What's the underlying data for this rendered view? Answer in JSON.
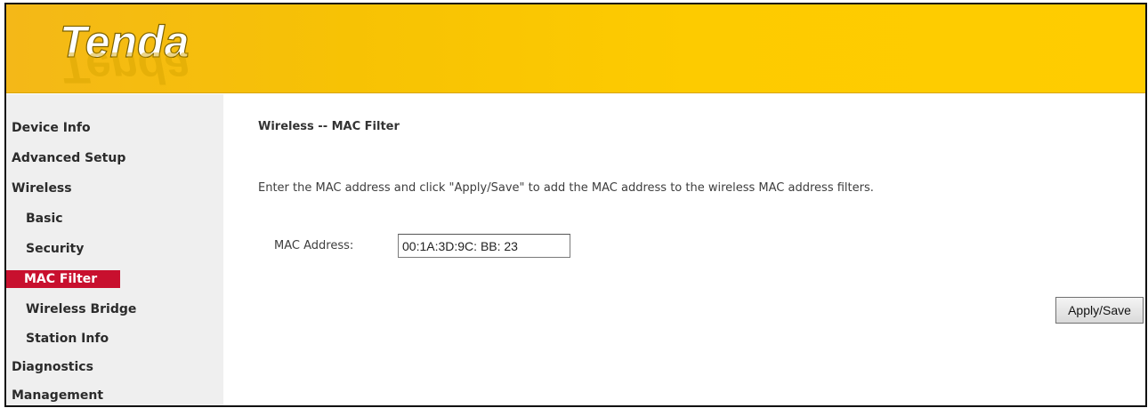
{
  "brand": {
    "logo_text": "Tenda"
  },
  "sidebar": {
    "items": [
      {
        "label": "Device Info"
      },
      {
        "label": "Advanced Setup"
      },
      {
        "label": "Wireless"
      },
      {
        "label": "Basic"
      },
      {
        "label": "Security"
      },
      {
        "label": "MAC Filter"
      },
      {
        "label": "Wireless Bridge"
      },
      {
        "label": "Station Info"
      },
      {
        "label": "Diagnostics"
      },
      {
        "label": "Management"
      }
    ]
  },
  "main": {
    "title": "Wireless -- MAC Filter",
    "description": "Enter the MAC address and click \"Apply/Save\" to add the MAC address to the wireless MAC address filters.",
    "mac_label": "MAC Address:",
    "mac_value": "00:1A:3D:9C: BB: 23",
    "apply_label": "Apply/Save"
  },
  "colors": {
    "header": "#ffcc00",
    "active_nav": "#c8102e",
    "sidebar_bg": "#efefef"
  }
}
